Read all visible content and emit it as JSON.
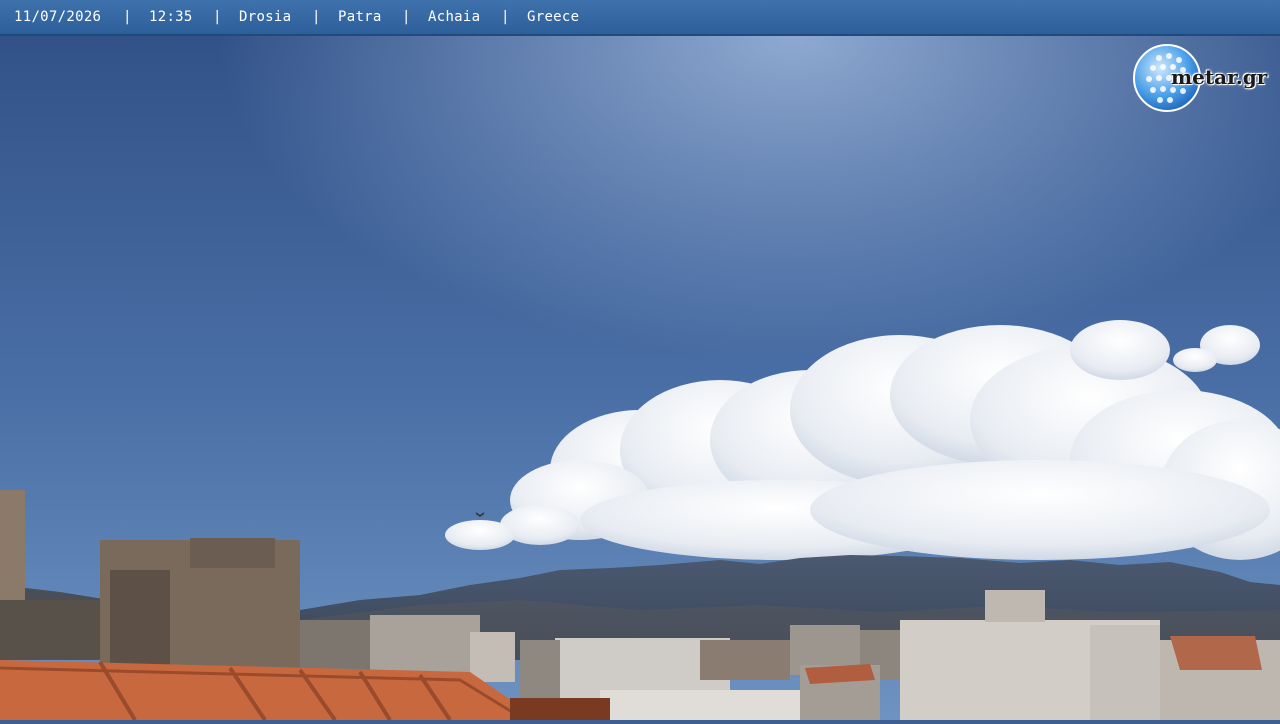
{
  "overlay": {
    "date": "11/07/2026",
    "sep1": "|",
    "time": "12:35",
    "sep2": "|",
    "place": "Drosia",
    "sep3": "|",
    "city": "Patra",
    "sep4": "|",
    "region": "Achaia",
    "sep5": "|",
    "country": "Greece"
  },
  "logo": {
    "text": "metar.gr"
  },
  "colors": {
    "bar": "#3a6aa6",
    "sky_top": "#2f4f86",
    "sky_bottom": "#5d86b9",
    "roof": "#c8683f"
  }
}
